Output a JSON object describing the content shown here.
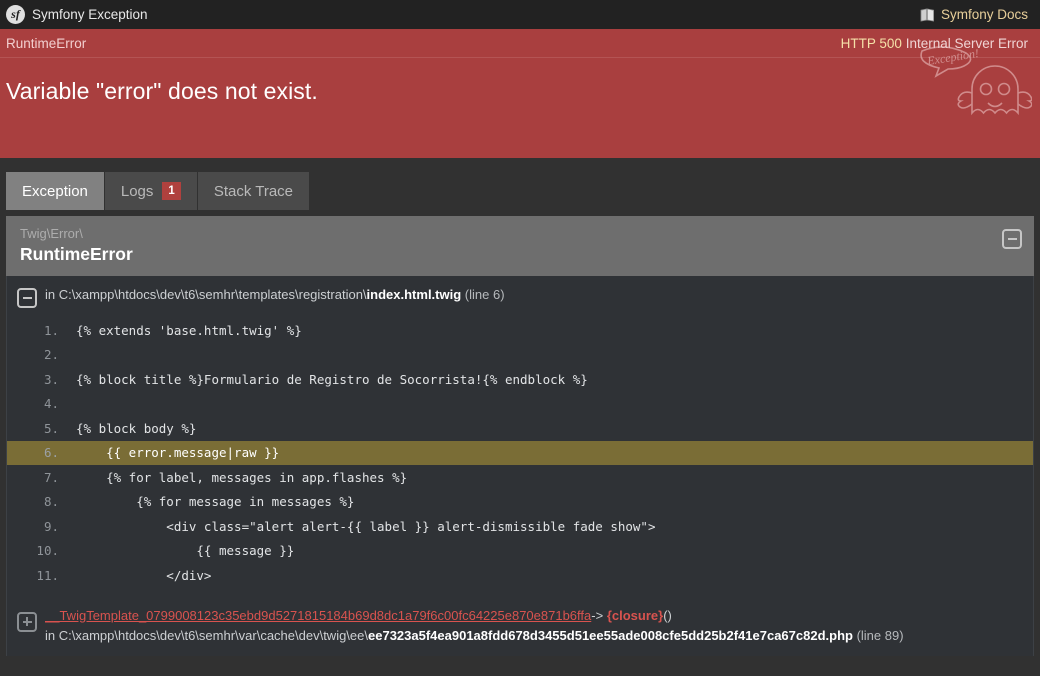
{
  "topbar": {
    "brand_label": "Symfony Exception",
    "logo_text": "sf",
    "docs_label": "Symfony Docs",
    "docs_icon": "book-icon"
  },
  "error_band": {
    "exception_name": "RuntimeError",
    "status_code": "HTTP 500",
    "status_text": "Internal Server Error",
    "message": "Variable \"error\" does not exist.",
    "mascot_bubble": "Exception!",
    "background_color": "#a93f3f"
  },
  "tabs": [
    {
      "label": "Exception",
      "badge": null,
      "active": true
    },
    {
      "label": "Logs",
      "badge": "1",
      "active": false
    },
    {
      "label": "Stack Trace",
      "badge": null,
      "active": false
    }
  ],
  "exception_card": {
    "namespace": "Twig\\Error\\",
    "class_name": "RuntimeError",
    "collapse_icon": "minus-icon"
  },
  "frames": [
    {
      "prefix": "in ",
      "directory": "C:\\xampp\\htdocs\\dev\\t6\\semhr\\templates\\registration\\",
      "file": "index.html.twig",
      "line_label": "(line 6)",
      "toggle_icon": "minus-icon",
      "code": [
        {
          "num": "1.",
          "text": "{% extends 'base.html.twig' %}",
          "highlight": false
        },
        {
          "num": "2.",
          "text": "",
          "highlight": false
        },
        {
          "num": "3.",
          "text": "{% block title %}Formulario de Registro de Socorrista!{% endblock %}",
          "highlight": false
        },
        {
          "num": "4.",
          "text": "",
          "highlight": false
        },
        {
          "num": "5.",
          "text": "{% block body %}",
          "highlight": false
        },
        {
          "num": "6.",
          "text": "    {{ error.message|raw }}",
          "highlight": true
        },
        {
          "num": "7.",
          "text": "    {% for label, messages in app.flashes %}",
          "highlight": false
        },
        {
          "num": "8.",
          "text": "        {% for message in messages %}",
          "highlight": false
        },
        {
          "num": "9.",
          "text": "            <div class=\"alert alert-{{ label }} alert-dismissible fade show\">",
          "highlight": false
        },
        {
          "num": "10.",
          "text": "                {{ message }}",
          "highlight": false
        },
        {
          "num": "11.",
          "text": "            </div>",
          "highlight": false
        }
      ]
    }
  ],
  "bottom_frame": {
    "toggle_icon": "plus-icon",
    "template_class": "__TwigTemplate_0799008123c35ebd9d5271815184b69d8dc1a79f6c00fc64225e870e871b6ffa",
    "arrow": "->",
    "closure": "{closure}",
    "parens": "()",
    "prefix": "in ",
    "directory": "C:\\xampp\\htdocs\\dev\\t6\\semhr\\var\\cache\\dev\\twig\\ee\\",
    "file": "ee7323a5f4ea901a8fdd678d3455d51ee55ade008cfe5dd25b2f41e7ca67c82d.php",
    "line_label": "(line 89)"
  }
}
